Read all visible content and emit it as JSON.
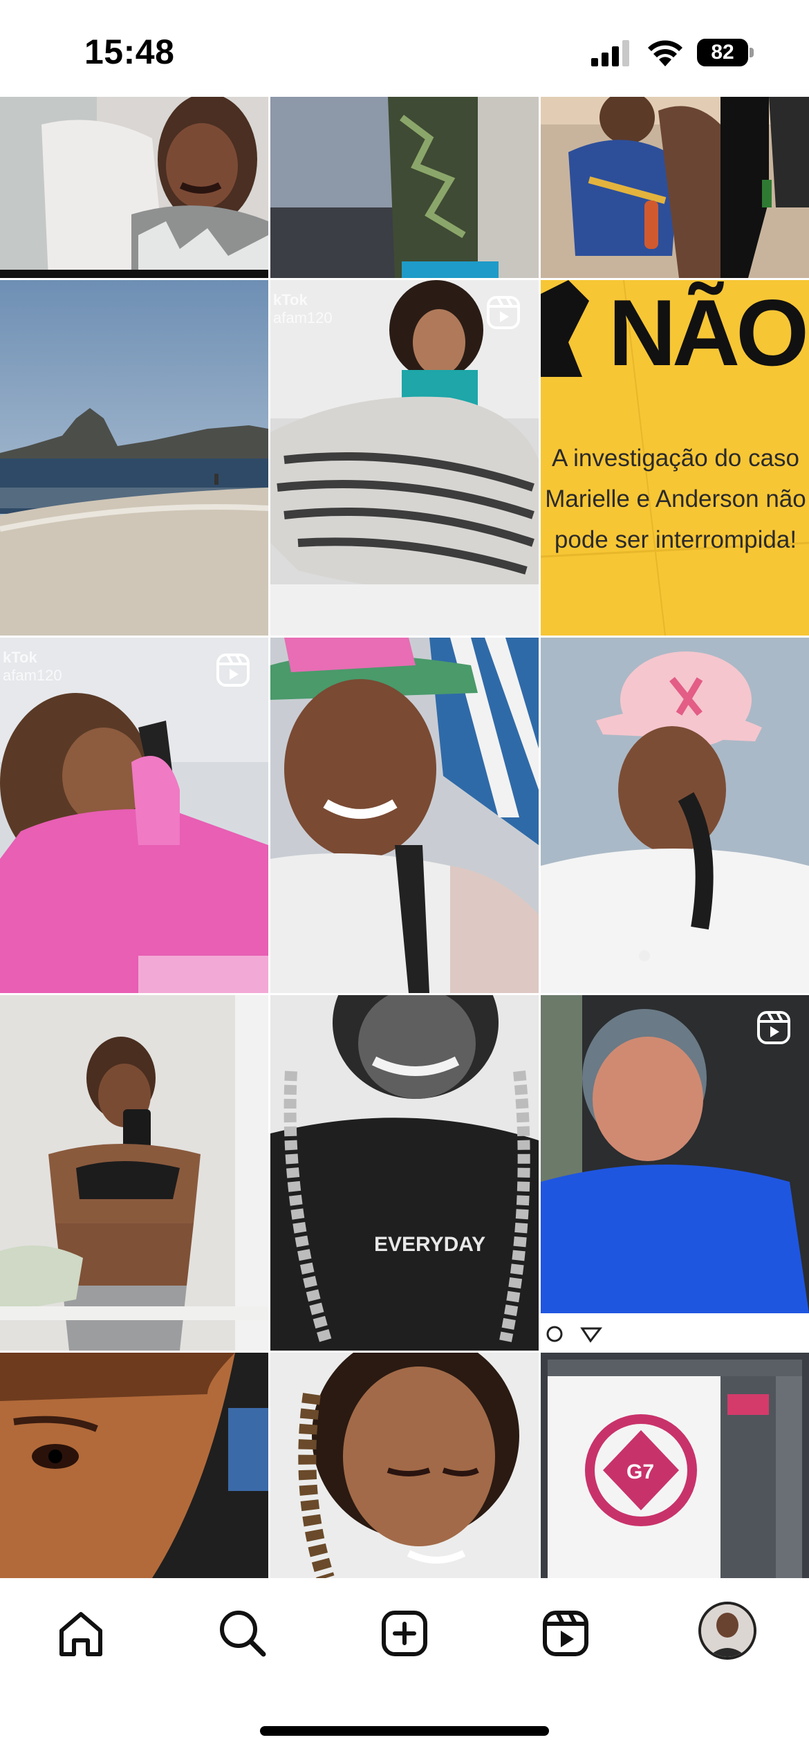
{
  "status_bar": {
    "time": "15:48",
    "battery_level": "82",
    "signal_icon": "cellular-signal-icon",
    "wifi_icon": "wifi-icon"
  },
  "grid": {
    "tiles": [
      {
        "label": "",
        "is_reel": false
      },
      {
        "label": "",
        "is_reel": false
      },
      {
        "label": "",
        "is_reel": false
      },
      {
        "label": "",
        "is_reel": false
      },
      {
        "label": "kTok afam120",
        "is_reel": true
      },
      {
        "label": "poster",
        "is_reel": false
      },
      {
        "label": "kTok afam120",
        "is_reel": true
      },
      {
        "label": "",
        "is_reel": false
      },
      {
        "label": "",
        "is_reel": false
      },
      {
        "label": "",
        "is_reel": false
      },
      {
        "label": "",
        "is_reel": false
      },
      {
        "label": "",
        "is_reel": true
      },
      {
        "label": "",
        "is_reel": false
      },
      {
        "label": "",
        "is_reel": false
      },
      {
        "label": "",
        "is_reel": false
      }
    ],
    "tiktok_caption_1": "kTok",
    "tiktok_handle_1": "afam120",
    "tiktok_caption_2": "kTok",
    "tiktok_handle_2": "afam120",
    "poster": {
      "headline": "NÃO",
      "body": "A investigação do caso Marielle e Anderson não pode ser interrompida!"
    },
    "shirt_text": "EVERYDAY",
    "logo_text": "G7"
  },
  "bottom_nav": {
    "items": [
      {
        "icon": "home-icon"
      },
      {
        "icon": "search-icon"
      },
      {
        "icon": "create-post-icon"
      },
      {
        "icon": "reels-icon"
      },
      {
        "icon": "profile-avatar"
      }
    ]
  },
  "colors": {
    "poster_yellow": "#f7c635",
    "nav_icon": "#111111",
    "background": "#ffffff"
  }
}
